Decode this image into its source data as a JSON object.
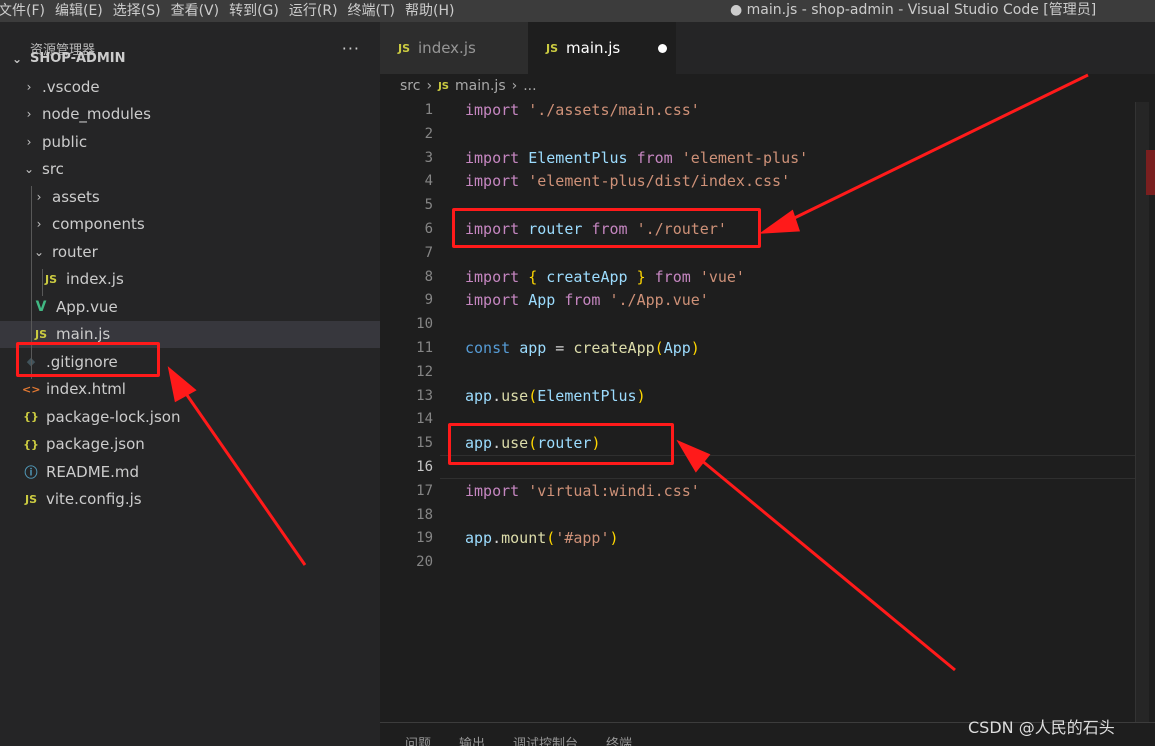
{
  "window": {
    "title": "● main.js - shop-admin - Visual Studio Code [管理员]",
    "menu": [
      "文件(F)",
      "编辑(E)",
      "选择(S)",
      "查看(V)",
      "转到(G)",
      "运行(R)",
      "终端(T)",
      "帮助(H)"
    ]
  },
  "sidebar": {
    "title": "资源管理器",
    "more": "···",
    "project": "SHOP-ADMIN",
    "items": [
      {
        "label": ".vscode",
        "type": "folder",
        "expanded": false
      },
      {
        "label": "node_modules",
        "type": "folder",
        "expanded": false
      },
      {
        "label": "public",
        "type": "folder",
        "expanded": false
      },
      {
        "label": "src",
        "type": "folder",
        "expanded": true
      },
      {
        "label": "assets",
        "type": "folder",
        "expanded": false
      },
      {
        "label": "components",
        "type": "folder",
        "expanded": false
      },
      {
        "label": "router",
        "type": "folder",
        "expanded": true
      },
      {
        "label": "index.js",
        "type": "js"
      },
      {
        "label": "App.vue",
        "type": "vue"
      },
      {
        "label": "main.js",
        "type": "js",
        "selected": true
      },
      {
        "label": ".gitignore",
        "type": "git"
      },
      {
        "label": "index.html",
        "type": "html"
      },
      {
        "label": "package-lock.json",
        "type": "json"
      },
      {
        "label": "package.json",
        "type": "json"
      },
      {
        "label": "README.md",
        "type": "info"
      },
      {
        "label": "vite.config.js",
        "type": "js"
      }
    ],
    "icons": {
      "js": "JS",
      "vue": "V",
      "git": "◆",
      "html": "<>",
      "json": "{}",
      "info": "ⓘ"
    }
  },
  "editor": {
    "tabs": [
      {
        "label": "index.js",
        "icon": "JS",
        "active": false
      },
      {
        "label": "main.js",
        "icon": "JS",
        "active": true,
        "dirty": true
      }
    ],
    "breadcrumb": {
      "folder": "src",
      "file_icon": "JS",
      "file": "main.js",
      "more": "..."
    },
    "current_line": 16,
    "lines": [
      {
        "n": "1",
        "tokens": [
          [
            "kw",
            "import"
          ],
          [
            "plain",
            " "
          ],
          [
            "str",
            "'./assets/main.css'"
          ]
        ]
      },
      {
        "n": "2",
        "tokens": []
      },
      {
        "n": "3",
        "tokens": [
          [
            "kw",
            "import"
          ],
          [
            "plain",
            " "
          ],
          [
            "var",
            "ElementPlus"
          ],
          [
            "plain",
            " "
          ],
          [
            "kw",
            "from"
          ],
          [
            "plain",
            " "
          ],
          [
            "str",
            "'element-plus'"
          ]
        ]
      },
      {
        "n": "4",
        "tokens": [
          [
            "kw",
            "import"
          ],
          [
            "plain",
            " "
          ],
          [
            "str",
            "'element-plus/dist/index.css'"
          ]
        ]
      },
      {
        "n": "5",
        "tokens": []
      },
      {
        "n": "6",
        "tokens": [
          [
            "kw",
            "import"
          ],
          [
            "plain",
            " "
          ],
          [
            "var",
            "router"
          ],
          [
            "plain",
            " "
          ],
          [
            "kw",
            "from"
          ],
          [
            "plain",
            " "
          ],
          [
            "str",
            "'./router'"
          ]
        ]
      },
      {
        "n": "7",
        "tokens": []
      },
      {
        "n": "8",
        "tokens": [
          [
            "kw",
            "import"
          ],
          [
            "plain",
            " "
          ],
          [
            "br1",
            "{"
          ],
          [
            "plain",
            " "
          ],
          [
            "var",
            "createApp"
          ],
          [
            "plain",
            " "
          ],
          [
            "br1",
            "}"
          ],
          [
            "plain",
            " "
          ],
          [
            "kw",
            "from"
          ],
          [
            "plain",
            " "
          ],
          [
            "str",
            "'vue'"
          ]
        ]
      },
      {
        "n": "9",
        "tokens": [
          [
            "kw",
            "import"
          ],
          [
            "plain",
            " "
          ],
          [
            "var",
            "App"
          ],
          [
            "plain",
            " "
          ],
          [
            "kw",
            "from"
          ],
          [
            "plain",
            " "
          ],
          [
            "str",
            "'./App.vue'"
          ]
        ]
      },
      {
        "n": "10",
        "tokens": []
      },
      {
        "n": "11",
        "tokens": [
          [
            "decl",
            "const"
          ],
          [
            "plain",
            " "
          ],
          [
            "var",
            "app"
          ],
          [
            "plain",
            " = "
          ],
          [
            "fn",
            "createApp"
          ],
          [
            "br1",
            "("
          ],
          [
            "var",
            "App"
          ],
          [
            "br1",
            ")"
          ]
        ]
      },
      {
        "n": "12",
        "tokens": []
      },
      {
        "n": "13",
        "tokens": [
          [
            "var",
            "app"
          ],
          [
            "plain",
            "."
          ],
          [
            "fn",
            "use"
          ],
          [
            "br1",
            "("
          ],
          [
            "var",
            "ElementPlus"
          ],
          [
            "br1",
            ")"
          ]
        ]
      },
      {
        "n": "14",
        "tokens": []
      },
      {
        "n": "15",
        "tokens": [
          [
            "var",
            "app"
          ],
          [
            "plain",
            "."
          ],
          [
            "fn",
            "use"
          ],
          [
            "br1",
            "("
          ],
          [
            "var",
            "router"
          ],
          [
            "br1",
            ")"
          ]
        ]
      },
      {
        "n": "16",
        "tokens": []
      },
      {
        "n": "17",
        "tokens": [
          [
            "kw",
            "import"
          ],
          [
            "plain",
            " "
          ],
          [
            "str",
            "'virtual:windi.css'"
          ]
        ]
      },
      {
        "n": "18",
        "tokens": []
      },
      {
        "n": "19",
        "tokens": [
          [
            "var",
            "app"
          ],
          [
            "plain",
            "."
          ],
          [
            "fn",
            "mount"
          ],
          [
            "br1",
            "("
          ],
          [
            "str",
            "'#app'"
          ],
          [
            "br1",
            ")"
          ]
        ]
      },
      {
        "n": "20",
        "tokens": []
      }
    ]
  },
  "panel": {
    "tabs": [
      "问题",
      "输出",
      "调试控制台",
      "终端"
    ]
  },
  "watermark": "CSDN @人民的石头",
  "colors": {
    "annotation": "#ff1a1a",
    "keyword": "#c586c0",
    "string": "#ce9178",
    "variable": "#9cdcfe",
    "function": "#dcdcaa"
  }
}
